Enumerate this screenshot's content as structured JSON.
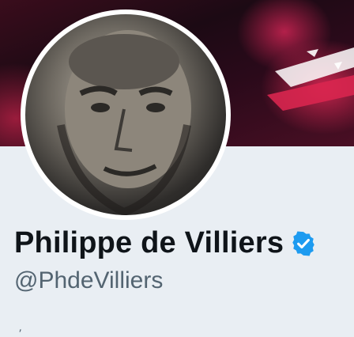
{
  "profile": {
    "display_name": "Philippe de Villiers",
    "handle": "@PhdeVilliers",
    "trailing_mark": "⸴",
    "verified": true,
    "verified_color": "#1d9bf0"
  },
  "icons": {
    "avatar": "avatar-photo",
    "verified": "verified-badge-icon"
  }
}
